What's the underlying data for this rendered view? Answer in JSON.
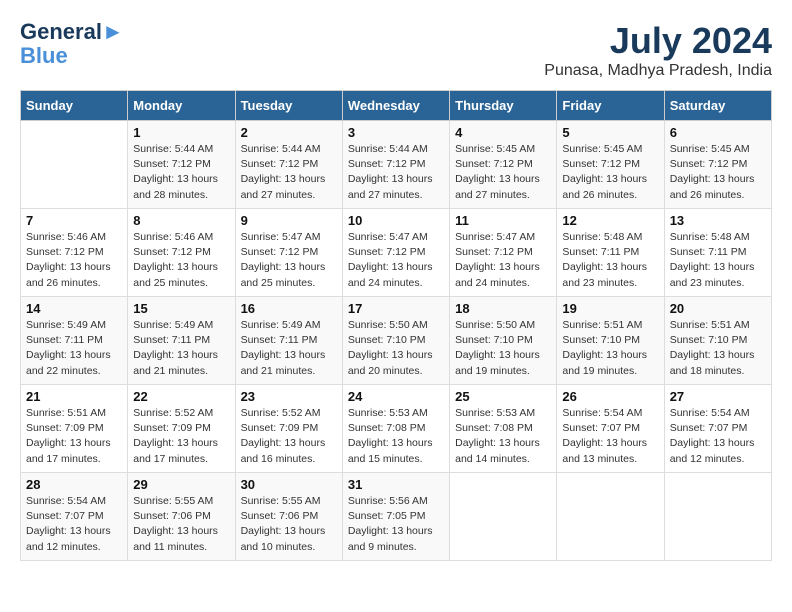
{
  "header": {
    "logo_line1": "General",
    "logo_line2": "Blue",
    "month": "July 2024",
    "location": "Punasa, Madhya Pradesh, India"
  },
  "days_of_week": [
    "Sunday",
    "Monday",
    "Tuesday",
    "Wednesday",
    "Thursday",
    "Friday",
    "Saturday"
  ],
  "weeks": [
    [
      {
        "day": "",
        "sunrise": "",
        "sunset": "",
        "daylight": ""
      },
      {
        "day": "1",
        "sunrise": "Sunrise: 5:44 AM",
        "sunset": "Sunset: 7:12 PM",
        "daylight": "Daylight: 13 hours and 28 minutes."
      },
      {
        "day": "2",
        "sunrise": "Sunrise: 5:44 AM",
        "sunset": "Sunset: 7:12 PM",
        "daylight": "Daylight: 13 hours and 27 minutes."
      },
      {
        "day": "3",
        "sunrise": "Sunrise: 5:44 AM",
        "sunset": "Sunset: 7:12 PM",
        "daylight": "Daylight: 13 hours and 27 minutes."
      },
      {
        "day": "4",
        "sunrise": "Sunrise: 5:45 AM",
        "sunset": "Sunset: 7:12 PM",
        "daylight": "Daylight: 13 hours and 27 minutes."
      },
      {
        "day": "5",
        "sunrise": "Sunrise: 5:45 AM",
        "sunset": "Sunset: 7:12 PM",
        "daylight": "Daylight: 13 hours and 26 minutes."
      },
      {
        "day": "6",
        "sunrise": "Sunrise: 5:45 AM",
        "sunset": "Sunset: 7:12 PM",
        "daylight": "Daylight: 13 hours and 26 minutes."
      }
    ],
    [
      {
        "day": "7",
        "sunrise": "Sunrise: 5:46 AM",
        "sunset": "Sunset: 7:12 PM",
        "daylight": "Daylight: 13 hours and 26 minutes."
      },
      {
        "day": "8",
        "sunrise": "Sunrise: 5:46 AM",
        "sunset": "Sunset: 7:12 PM",
        "daylight": "Daylight: 13 hours and 25 minutes."
      },
      {
        "day": "9",
        "sunrise": "Sunrise: 5:47 AM",
        "sunset": "Sunset: 7:12 PM",
        "daylight": "Daylight: 13 hours and 25 minutes."
      },
      {
        "day": "10",
        "sunrise": "Sunrise: 5:47 AM",
        "sunset": "Sunset: 7:12 PM",
        "daylight": "Daylight: 13 hours and 24 minutes."
      },
      {
        "day": "11",
        "sunrise": "Sunrise: 5:47 AM",
        "sunset": "Sunset: 7:12 PM",
        "daylight": "Daylight: 13 hours and 24 minutes."
      },
      {
        "day": "12",
        "sunrise": "Sunrise: 5:48 AM",
        "sunset": "Sunset: 7:11 PM",
        "daylight": "Daylight: 13 hours and 23 minutes."
      },
      {
        "day": "13",
        "sunrise": "Sunrise: 5:48 AM",
        "sunset": "Sunset: 7:11 PM",
        "daylight": "Daylight: 13 hours and 23 minutes."
      }
    ],
    [
      {
        "day": "14",
        "sunrise": "Sunrise: 5:49 AM",
        "sunset": "Sunset: 7:11 PM",
        "daylight": "Daylight: 13 hours and 22 minutes."
      },
      {
        "day": "15",
        "sunrise": "Sunrise: 5:49 AM",
        "sunset": "Sunset: 7:11 PM",
        "daylight": "Daylight: 13 hours and 21 minutes."
      },
      {
        "day": "16",
        "sunrise": "Sunrise: 5:49 AM",
        "sunset": "Sunset: 7:11 PM",
        "daylight": "Daylight: 13 hours and 21 minutes."
      },
      {
        "day": "17",
        "sunrise": "Sunrise: 5:50 AM",
        "sunset": "Sunset: 7:10 PM",
        "daylight": "Daylight: 13 hours and 20 minutes."
      },
      {
        "day": "18",
        "sunrise": "Sunrise: 5:50 AM",
        "sunset": "Sunset: 7:10 PM",
        "daylight": "Daylight: 13 hours and 19 minutes."
      },
      {
        "day": "19",
        "sunrise": "Sunrise: 5:51 AM",
        "sunset": "Sunset: 7:10 PM",
        "daylight": "Daylight: 13 hours and 19 minutes."
      },
      {
        "day": "20",
        "sunrise": "Sunrise: 5:51 AM",
        "sunset": "Sunset: 7:10 PM",
        "daylight": "Daylight: 13 hours and 18 minutes."
      }
    ],
    [
      {
        "day": "21",
        "sunrise": "Sunrise: 5:51 AM",
        "sunset": "Sunset: 7:09 PM",
        "daylight": "Daylight: 13 hours and 17 minutes."
      },
      {
        "day": "22",
        "sunrise": "Sunrise: 5:52 AM",
        "sunset": "Sunset: 7:09 PM",
        "daylight": "Daylight: 13 hours and 17 minutes."
      },
      {
        "day": "23",
        "sunrise": "Sunrise: 5:52 AM",
        "sunset": "Sunset: 7:09 PM",
        "daylight": "Daylight: 13 hours and 16 minutes."
      },
      {
        "day": "24",
        "sunrise": "Sunrise: 5:53 AM",
        "sunset": "Sunset: 7:08 PM",
        "daylight": "Daylight: 13 hours and 15 minutes."
      },
      {
        "day": "25",
        "sunrise": "Sunrise: 5:53 AM",
        "sunset": "Sunset: 7:08 PM",
        "daylight": "Daylight: 13 hours and 14 minutes."
      },
      {
        "day": "26",
        "sunrise": "Sunrise: 5:54 AM",
        "sunset": "Sunset: 7:07 PM",
        "daylight": "Daylight: 13 hours and 13 minutes."
      },
      {
        "day": "27",
        "sunrise": "Sunrise: 5:54 AM",
        "sunset": "Sunset: 7:07 PM",
        "daylight": "Daylight: 13 hours and 12 minutes."
      }
    ],
    [
      {
        "day": "28",
        "sunrise": "Sunrise: 5:54 AM",
        "sunset": "Sunset: 7:07 PM",
        "daylight": "Daylight: 13 hours and 12 minutes."
      },
      {
        "day": "29",
        "sunrise": "Sunrise: 5:55 AM",
        "sunset": "Sunset: 7:06 PM",
        "daylight": "Daylight: 13 hours and 11 minutes."
      },
      {
        "day": "30",
        "sunrise": "Sunrise: 5:55 AM",
        "sunset": "Sunset: 7:06 PM",
        "daylight": "Daylight: 13 hours and 10 minutes."
      },
      {
        "day": "31",
        "sunrise": "Sunrise: 5:56 AM",
        "sunset": "Sunset: 7:05 PM",
        "daylight": "Daylight: 13 hours and 9 minutes."
      },
      {
        "day": "",
        "sunrise": "",
        "sunset": "",
        "daylight": ""
      },
      {
        "day": "",
        "sunrise": "",
        "sunset": "",
        "daylight": ""
      },
      {
        "day": "",
        "sunrise": "",
        "sunset": "",
        "daylight": ""
      }
    ]
  ]
}
